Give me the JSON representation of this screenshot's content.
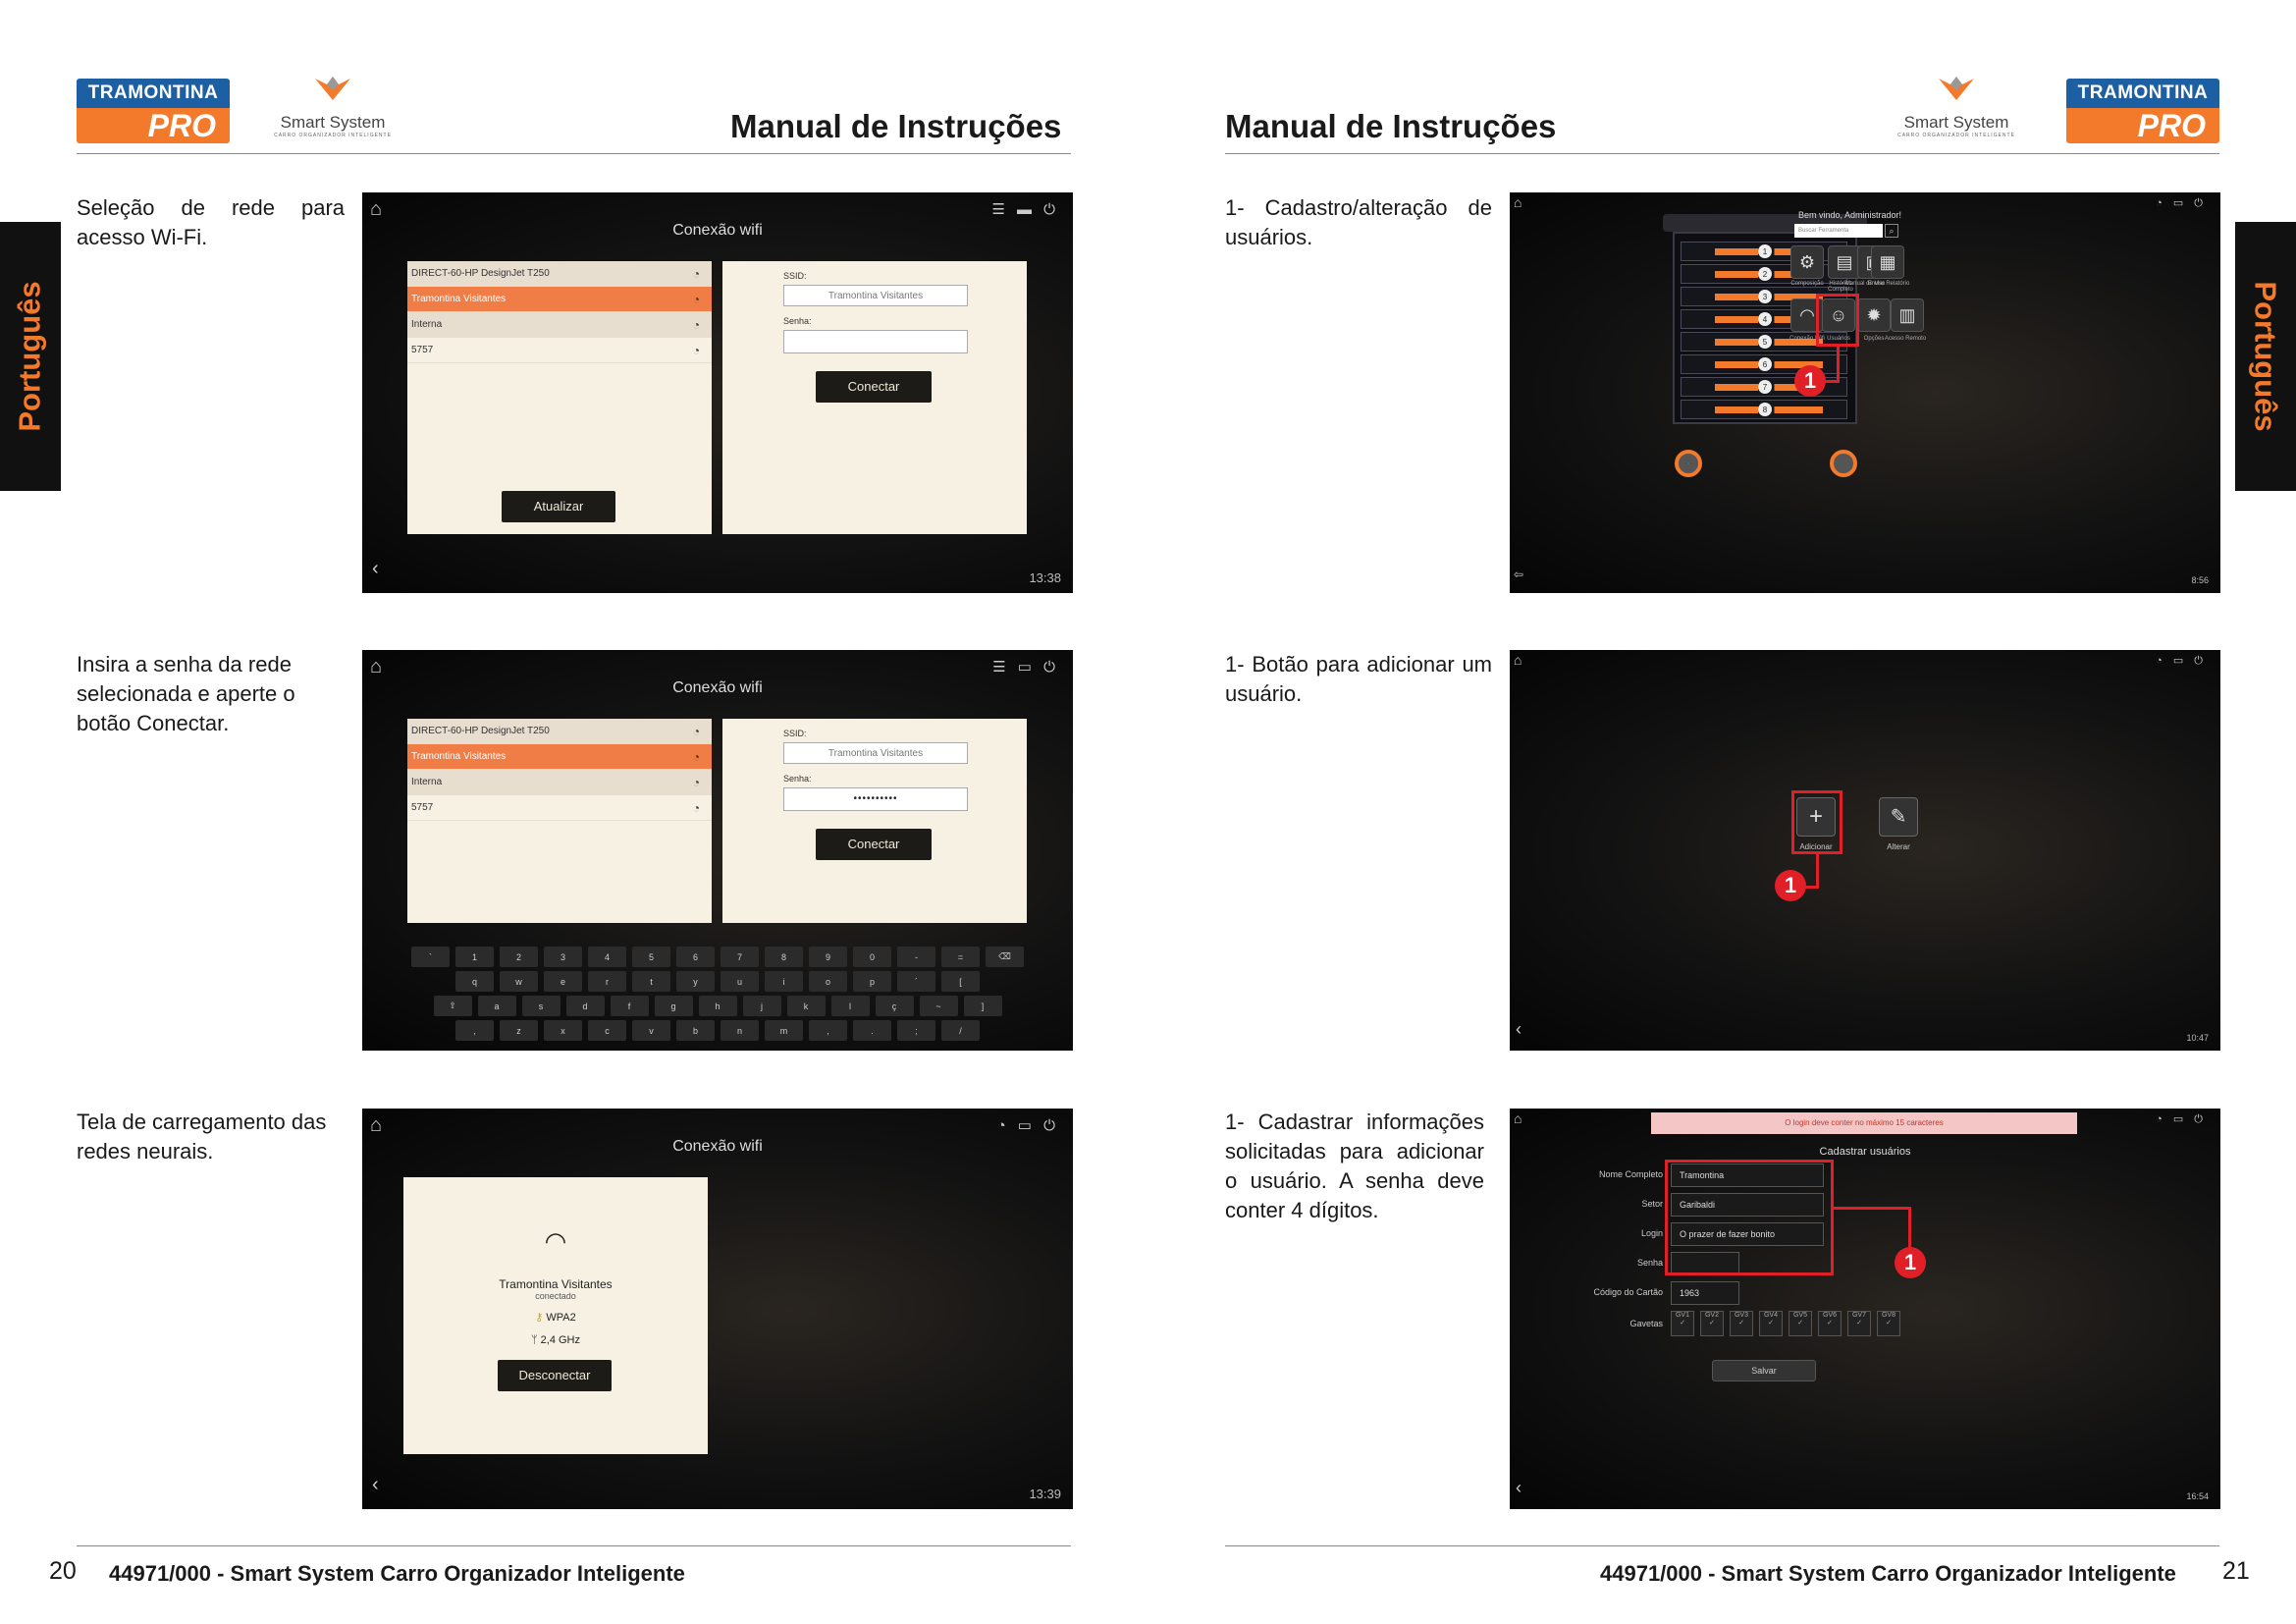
{
  "header": {
    "brand_top": "TRAMONTINA",
    "brand_bottom": "PRO",
    "smart_system": "Smart System",
    "smart_system_sub": "CARRO ORGANIZADOR INTELIGENTE",
    "title": "Manual de Instruções"
  },
  "side_tab": "Português",
  "left_page": {
    "page_number": "20",
    "footer": "44971/000 - Smart System Carro Organizador Inteligente",
    "steps": [
      {
        "text": "Seleção de rede para acesso Wi-Fi."
      },
      {
        "text": "Insira a senha da rede selecionada e aperte o botão Conectar."
      },
      {
        "text": "Tela de carregamento das redes neurais."
      }
    ]
  },
  "right_page": {
    "page_number": "21",
    "footer": "44971/000 - Smart System Carro Organizador Inteligente",
    "steps": [
      {
        "text": "1- Cadastro/alteração de usuários."
      },
      {
        "text": "1- Botão para adicionar um usuário."
      },
      {
        "text": "1- Cadastrar informações solicitadas para adicionar o usuário. A senha deve conter 4 dígitos."
      }
    ]
  },
  "wifi_screen": {
    "title": "Conexão wifi",
    "networks": [
      "DIRECT-60-HP DesignJet T250",
      "Tramontina Visitantes",
      "Interna",
      "5757"
    ],
    "ssid_label": "SSID:",
    "ssid_value": "Tramontina Visitantes",
    "password_label": "Senha:",
    "password_masked": "••••••••••",
    "connect_button": "Conectar",
    "refresh_button": "Atualizar",
    "time_1": "13:38",
    "time_2": "13:39"
  },
  "keyboard": {
    "row1": [
      "`",
      "1",
      "2",
      "3",
      "4",
      "5",
      "6",
      "7",
      "8",
      "9",
      "0",
      "-",
      "=",
      "⌫"
    ],
    "row2": [
      "q",
      "w",
      "e",
      "r",
      "t",
      "y",
      "u",
      "i",
      "o",
      "p",
      "´",
      "["
    ],
    "row3": [
      "⇧",
      "a",
      "s",
      "d",
      "f",
      "g",
      "h",
      "j",
      "k",
      "l",
      "ç",
      "~",
      "]"
    ],
    "row4": [
      ",",
      "z",
      "x",
      "c",
      "v",
      "b",
      "n",
      "m",
      ",",
      ".",
      ";",
      "/"
    ]
  },
  "connected_screen": {
    "network": "Tramontina Visitantes",
    "status": "conectado",
    "security": "WPA2",
    "frequency": "2,4 GHz",
    "disconnect_button": "Desconectar"
  },
  "home_screen": {
    "welcome": "Bem vindo, Administrador!",
    "search_placeholder": "Buscar Ferramenta",
    "drawer_numbers": [
      "1",
      "2",
      "3",
      "4",
      "5",
      "6",
      "7",
      "8"
    ],
    "apps": [
      "Composição",
      "Histórico Completo",
      "Manual de Uso",
      "Enviar Relatório",
      "Conexão Wifi",
      "Usuários",
      "Opções",
      "Acesso Remoto"
    ],
    "time": "8:56",
    "badge": "1"
  },
  "users_screen": {
    "add_label": "Adicionar",
    "edit_label": "Alterar",
    "time": "10:47",
    "badge": "1"
  },
  "register_screen": {
    "warning": "O login deve conter no máximo 15 caracteres",
    "title": "Cadastrar usuários",
    "fields": [
      {
        "label": "Nome Completo",
        "value": "Tramontina"
      },
      {
        "label": "Setor",
        "value": "Garibaldi"
      },
      {
        "label": "Login",
        "value": "O prazer de fazer bonito"
      },
      {
        "label": "Senha",
        "value": ""
      },
      {
        "label": "Código do Cartão",
        "value": "1963"
      }
    ],
    "drawers_label": "Gavetas",
    "drawers": [
      "GV1",
      "GV2",
      "GV3",
      "GV4",
      "GV5",
      "GV6",
      "GV7",
      "GV8"
    ],
    "save_button": "Salvar",
    "time": "16:54",
    "badge": "1"
  },
  "colors": {
    "orange": "#f37a2a",
    "blue": "#1d5fa3",
    "red": "#e11f26"
  }
}
